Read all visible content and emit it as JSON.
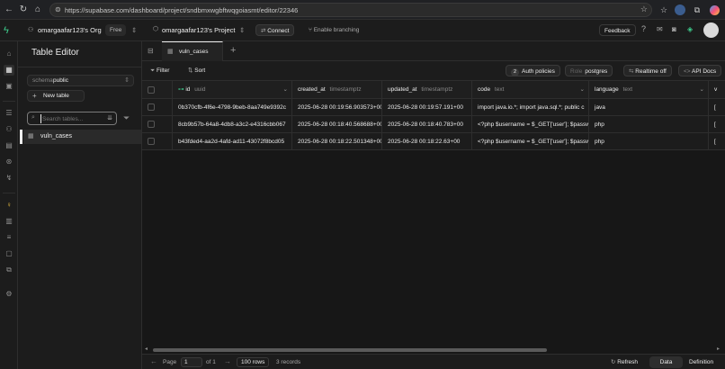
{
  "browser": {
    "url": "https://supabase.com/dashboard/project/sndbmxwgbftwqgoiasmt/editor/22346"
  },
  "header": {
    "org": "omargaafar123's Org",
    "plan": "Free",
    "project": "omargaafar123's Project",
    "connect": "Connect",
    "branching": "Enable branching",
    "feedback": "Feedback"
  },
  "sidebar": {
    "title": "Table Editor",
    "schema_label": "schema",
    "schema_value": "public",
    "new_table": "New table",
    "search_placeholder": "Search tables...",
    "tables": [
      "vuln_cases"
    ]
  },
  "tab": {
    "label": "vuln_cases"
  },
  "toolbar": {
    "filter": "Filter",
    "sort": "Sort",
    "auth_count": "2",
    "auth_policies": "Auth policies",
    "role_label": "Role",
    "role_value": "postgres",
    "realtime": "Realtime off",
    "api_docs": "API Docs"
  },
  "table": {
    "columns": [
      {
        "name": "id",
        "type": "uuid"
      },
      {
        "name": "created_at",
        "type": "timestamptz"
      },
      {
        "name": "updated_at",
        "type": "timestamptz"
      },
      {
        "name": "code",
        "type": "text"
      },
      {
        "name": "language",
        "type": "text"
      },
      {
        "name": "v",
        "type": ""
      }
    ],
    "rows": [
      [
        "0b370cfb-4f6e-4798-9beb-8aa749e9392c",
        "2025-06-28 00:19:56.903573+00",
        "2025-06-28 00:19:57.191+00",
        "import java.io.*; import java.sql.*; public c",
        "java",
        "["
      ],
      [
        "8cb9b57b-64a8-4db8-a3c2-e4316cbb067",
        "2025-06-28 00:18:40.568688+00",
        "2025-06-28 00:18:40.783+00",
        "<?php $username = $_GET['user']; $passw",
        "php",
        "["
      ],
      [
        "b43fded4-aa2d-4afd-ad11-43072f8bcd05",
        "2025-06-28 00:18:22.501348+00",
        "2025-06-28 00:18:22.63+00",
        "<?php $username = $_GET['user']; $passw",
        "php",
        "["
      ]
    ]
  },
  "footer": {
    "page_label": "Page",
    "page_value": "1",
    "of_label": "of 1",
    "rows_per_page": "100 rows",
    "record_count": "3 records",
    "refresh": "Refresh",
    "data_tab": "Data",
    "definition_tab": "Definition"
  },
  "colors": {
    "accent": "#3ecf8e",
    "bg": "#1c1c1c",
    "border": "#2e2e2e"
  }
}
